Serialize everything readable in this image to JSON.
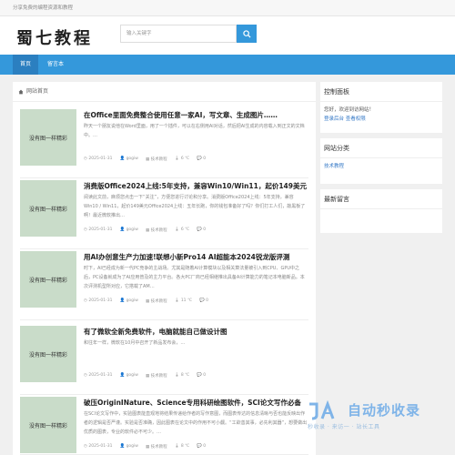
{
  "topbar": {
    "text": "分享免费的编程资源和教程"
  },
  "header": {
    "logo": "蜀七教程"
  },
  "search": {
    "placeholder": "输入关键字"
  },
  "nav": {
    "items": [
      "首页",
      "留言本"
    ]
  },
  "breadcrumb": {
    "label": "网站首页"
  },
  "posts": [
    {
      "thumb": "没有图一样精彩",
      "title": "在Office里面免费整合使用任意一家AI，写文章、生成图片……",
      "excerpt": "昨天一个朋友说他在Word里面，用了一个插件，可以在右侧用AI对话，然后把AI生成的内容载入到正文的文档中。…",
      "date": "2025-01-31",
      "author": "gogiw",
      "category": "技术教程",
      "temp": "6 ℃",
      "comments": "0"
    },
    {
      "thumb": "没有图一样精彩",
      "title": "消费版Office2024上线:5年支持，兼容Win10/Win11，起价149美元",
      "excerpt": "阅读此文前，麻烦您点击一下“关注”，方便您进行讨论和分享。消费版Office2024上线：5年支持，兼容Win10 / Win11，起价149美元Office2024上线：五年长跑，你的钱包准备好了吗？你们打工人们，敲黑板了啊！最近微软推出…",
      "date": "2025-01-31",
      "author": "gogiw",
      "category": "技术教程",
      "temp": "6 ℃",
      "comments": "0"
    },
    {
      "thumb": "没有图一样精彩",
      "title": "用AI办创意生产力加速!联想小新Pro14 AI超能本2024锐龙版评测",
      "excerpt": "时下，AI已经成为新一代PC竞争的主战场。尤其是随着AI计算模块以及相关算法量被引入到CPU、GPU中之后，PC设备就成为了AI应用普及的主力平台。各大PC厂商已经相继推出具备AI计算能力的笔记本电脑新品。本次评测机型所对应，它搭载了AM…",
      "date": "2025-01-31",
      "author": "gogiw",
      "category": "技术教程",
      "temp": "11 ℃",
      "comments": "0"
    },
    {
      "thumb": "没有图一样精彩",
      "title": "有了微软全新免费软件，电脑就能自己做设计图",
      "excerpt": "和往年一样，微软在10月中召开了新品发布会，…",
      "date": "2025-01-31",
      "author": "gogiw",
      "category": "技术教程",
      "temp": "8 ℃",
      "comments": "0"
    },
    {
      "thumb": "没有图一样精彩",
      "title": "破压OriginINature、Science专用科研绘图软件，SCI论文写作必备",
      "excerpt": "在SCI论文写作中，实验图表能直观地将结果传递给作者的写作意图，而图表传达的信息清晰与否也能反映出作者的逻辑是否严谨。实验是否准确，因此图表在论文中的作用不可小觑。“工欲善其事，必先利其器”，想要做出优质的图表，专业的软件必不可少。…",
      "date": "2025-01-31",
      "author": "gogiw",
      "category": "技术教程",
      "temp": "8 ℃",
      "comments": "0"
    }
  ],
  "sidebar": {
    "control": {
      "title": "控制面板",
      "greeting": "您好，欢迎到访网站！",
      "login": "登录后台",
      "view": "查看权限"
    },
    "categories": {
      "title": "网站分类",
      "items": [
        "技术教程"
      ]
    },
    "recent": {
      "title": "最新留言"
    }
  },
  "watermark": {
    "brand": "自动秒收录",
    "slogan": "秒收录 · 来访一 · 站长工具"
  },
  "colors": {
    "accent": "#3498db",
    "thumb_bg": "#c9dcc9"
  }
}
